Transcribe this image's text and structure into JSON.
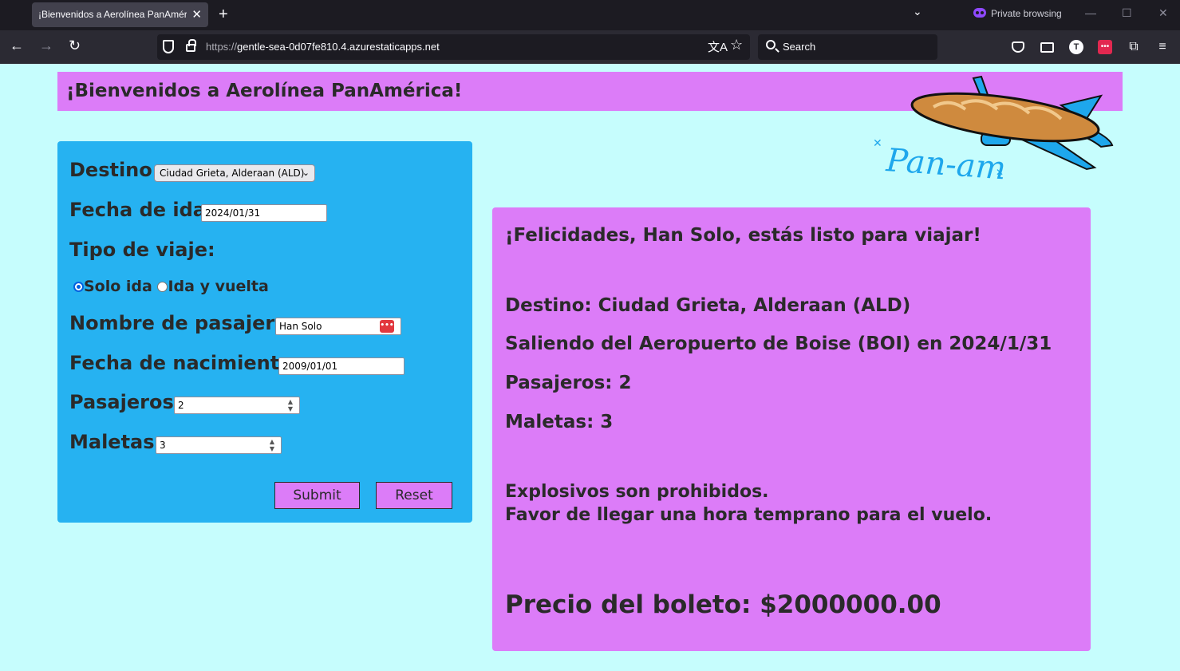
{
  "browser": {
    "tab_title": "¡Bienvenidos a Aerolínea PanAmérica!",
    "private_label": "Private browsing",
    "url_scheme": "https://",
    "url_host": "gentle-sea-0d07fe810.4.azurestaticapps.net",
    "search_placeholder": "Search",
    "avatar_initial": "T"
  },
  "header": {
    "title": "¡Bienvenidos a Aerolínea PanAmérica!"
  },
  "logo": {
    "text": "Pan-am"
  },
  "form": {
    "destino_label": "Destino:",
    "destino_value": "Ciudad Grieta, Alderaan (ALD)",
    "fecha_ida_label": "Fecha de ida:",
    "fecha_ida_value": "2024/01/31",
    "tipo_viaje_label": "Tipo de viaje:",
    "solo_ida_label": "Solo ida",
    "ida_vuelta_label": "Ida y vuelta",
    "nombre_label": "Nombre de pasajero:",
    "nombre_value": "Han Solo",
    "nacimiento_label": "Fecha de nacimiento:",
    "nacimiento_value": "2009/01/01",
    "pasajeros_label": "Pasajeros:",
    "pasajeros_value": "2",
    "maletas_label": "Maletas:",
    "maletas_value": "3",
    "submit_label": "Submit",
    "reset_label": "Reset"
  },
  "result": {
    "congrats": "¡Felicidades, Han Solo, estás listo para viajar!",
    "destino": "Destino: Ciudad Grieta, Alderaan (ALD)",
    "saliendo": "Saliendo del Aeropuerto de Boise (BOI) en 2024/1/31",
    "pasajeros": "Pasajeros: 2",
    "maletas": "Maletas: 3",
    "aviso1": "Explosivos son prohibidos.",
    "aviso2": "Favor de llegar una hora temprano para el vuelo.",
    "precio": "Precio del boleto: $2000000.00"
  },
  "colors": {
    "page_bg": "#c6fdfd",
    "header_bg": "#dc7cf8",
    "form_bg": "#26b2f1",
    "result_bg": "#dc7cf8"
  }
}
